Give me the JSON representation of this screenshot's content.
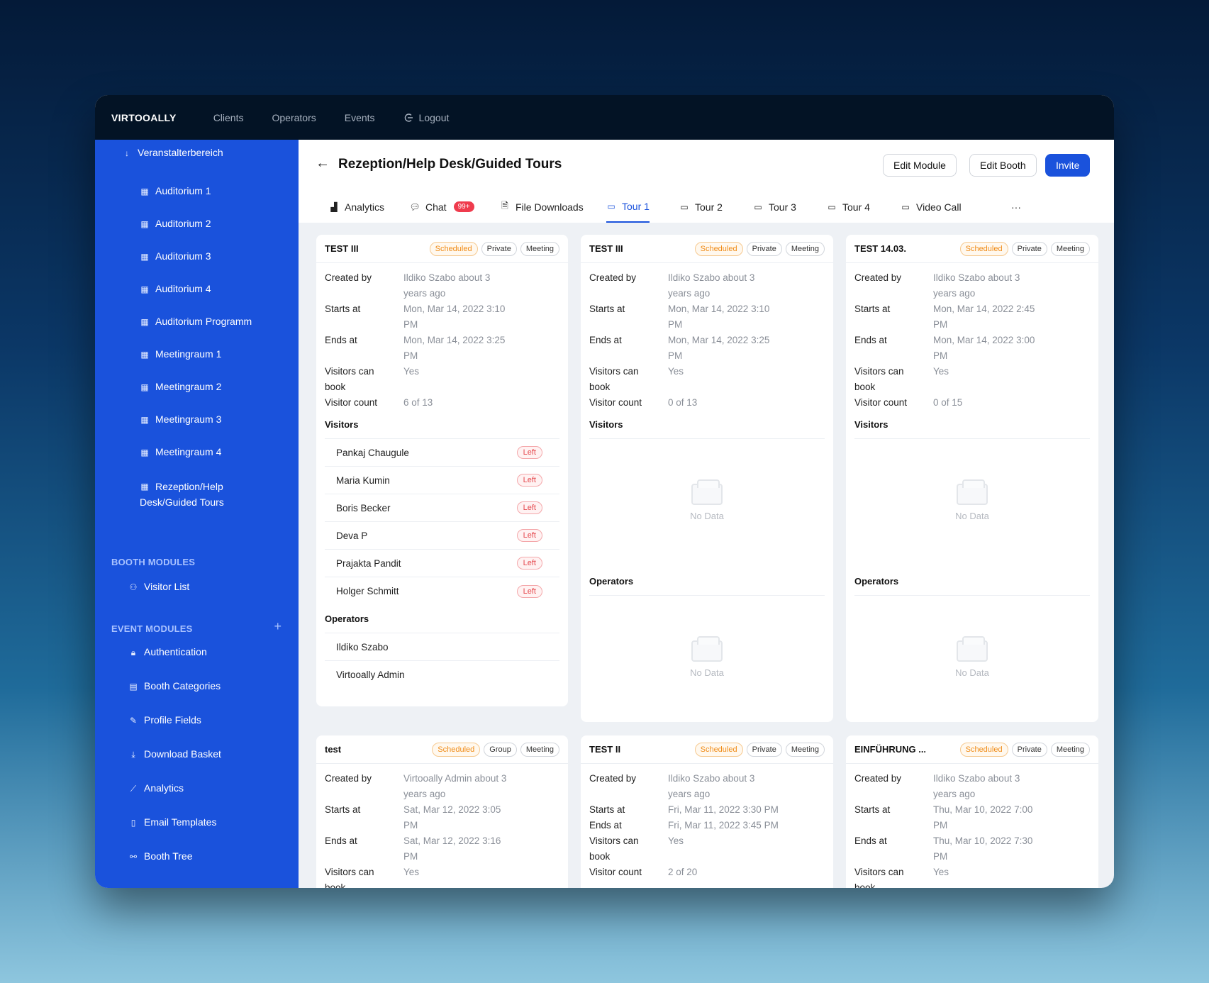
{
  "topbar": {
    "brand": "VIRTOOALLY",
    "nav": [
      "Clients",
      "Operators",
      "Events",
      "Logout"
    ]
  },
  "sidebar": {
    "group_label": "Veranstalterbereich",
    "rooms": [
      "Auditorium 1",
      "Auditorium 2",
      "Auditorium 3",
      "Auditorium 4",
      "Auditorium Programm",
      "Meetingraum 1",
      "Meetingraum 2",
      "Meetingraum 3",
      "Meetingraum 4"
    ],
    "active_room_line1": "Rezeption/Help",
    "active_room_line2": "Desk/Guided Tours",
    "booth_modules_title": "BOOTH MODULES",
    "booth_modules": [
      "Visitor List"
    ],
    "event_modules_title": "EVENT MODULES",
    "event_modules": [
      "Authentication",
      "Booth Categories",
      "Profile Fields",
      "Download Basket",
      "Analytics",
      "Email Templates",
      "Booth Tree"
    ]
  },
  "header": {
    "title": "Rezeption/Help Desk/Guided Tours",
    "edit_module": "Edit Module",
    "edit_booth": "Edit Booth",
    "invite": "Invite"
  },
  "tabs": {
    "analytics": "Analytics",
    "chat": "Chat",
    "chat_count": "99+",
    "file_downloads": "File Downloads",
    "tour1": "Tour 1",
    "tour2": "Tour 2",
    "tour3": "Tour 3",
    "tour4": "Tour 4",
    "video_call": "Video Call",
    "more": "···"
  },
  "labels": {
    "created_by": "Created by",
    "starts_at": "Starts at",
    "ends_at": "Ends at",
    "visitors_can": "Visitors can",
    "book": "book",
    "visitor_count": "Visitor count",
    "visitors": "Visitors",
    "operators": "Operators",
    "no_data": "No Data",
    "left": "Left",
    "scheduled": "Scheduled",
    "private": "Private",
    "group": "Group",
    "meeting": "Meeting"
  },
  "cards": [
    {
      "name": "TEST III",
      "type": "Private",
      "created_l1": "Ildiko Szabo about 3",
      "created_l2": "years ago",
      "start_l1": "Mon, Mar 14, 2022 3:10",
      "start_l2": "PM",
      "end_l1": "Mon, Mar 14, 2022 3:25",
      "end_l2": "PM",
      "can_book": "Yes",
      "count": "6 of 13",
      "visitors": [
        "Pankaj Chaugule",
        "Maria Kumin",
        "Boris Becker",
        "Deva P",
        "Prajakta Pandit",
        "Holger Schmitt"
      ],
      "operators": [
        "Ildiko Szabo",
        "Virtooally Admin"
      ]
    },
    {
      "name": "TEST III",
      "type": "Private",
      "created_l1": "Ildiko Szabo about 3",
      "created_l2": "years ago",
      "start_l1": "Mon, Mar 14, 2022 3:10",
      "start_l2": "PM",
      "end_l1": "Mon, Mar 14, 2022 3:25",
      "end_l2": "PM",
      "can_book": "Yes",
      "count": "0 of 13"
    },
    {
      "name": "TEST 14.03.",
      "type": "Private",
      "created_l1": "Ildiko Szabo about 3",
      "created_l2": "years ago",
      "start_l1": "Mon, Mar 14, 2022 2:45",
      "start_l2": "PM",
      "end_l1": "Mon, Mar 14, 2022 3:00",
      "end_l2": "PM",
      "can_book": "Yes",
      "count": "0 of 15"
    },
    {
      "name": "test",
      "type": "Group",
      "created_l1": "Virtooally Admin about 3",
      "created_l2": "years ago",
      "start_l1": "Sat, Mar 12, 2022 3:05",
      "start_l2": "PM",
      "end_l1": "Sat, Mar 12, 2022 3:16",
      "end_l2": "PM",
      "can_book": "Yes"
    },
    {
      "name": "TEST II",
      "type": "Private",
      "created_l1": "Ildiko Szabo about 3",
      "created_l2": "years ago",
      "start_l1": "Fri, Mar 11, 2022 3:30 PM",
      "end_l1": "Fri, Mar 11, 2022 3:45 PM",
      "can_book": "Yes",
      "count": "2 of 20"
    },
    {
      "name": "EINFÜHRUNG ...",
      "type": "Private",
      "created_l1": "Ildiko Szabo about 3",
      "created_l2": "years ago",
      "start_l1": "Thu, Mar 10, 2022 7:00",
      "start_l2": "PM",
      "end_l1": "Thu, Mar 10, 2022 7:30",
      "end_l2": "PM",
      "can_book": "Yes"
    }
  ]
}
